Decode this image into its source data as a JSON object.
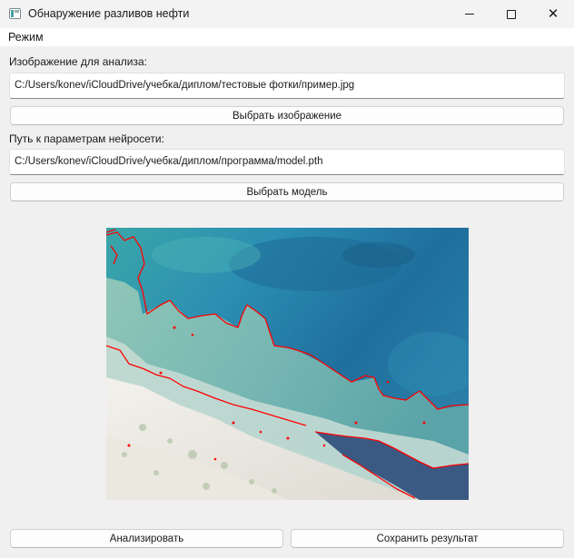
{
  "window": {
    "title": "Обнаружение разливов нефти",
    "controls": {
      "minimize": "minimize-icon",
      "maximize": "maximize-icon",
      "close": "close-icon"
    }
  },
  "menubar": {
    "items": [
      {
        "label": "Режим"
      }
    ]
  },
  "image_section": {
    "label": "Изображение для анализа:",
    "path": "C:/Users/konev/iCloudDrive/учебка/диплом/тестовые фотки/пример.jpg",
    "button_label": "Выбрать изображение"
  },
  "model_section": {
    "label": "Путь к параметрам нейросети:",
    "path": "C:/Users/konev/iCloudDrive/учебка/диплом/программа/model.pth",
    "button_label": "Выбрать модель"
  },
  "preview": {
    "content": "aerial coastline photo with red oil-spill contour overlay",
    "overlay_color": "#ff0000"
  },
  "actions": {
    "analyze_label": "Анализировать",
    "save_label": "Сохранить результат"
  }
}
